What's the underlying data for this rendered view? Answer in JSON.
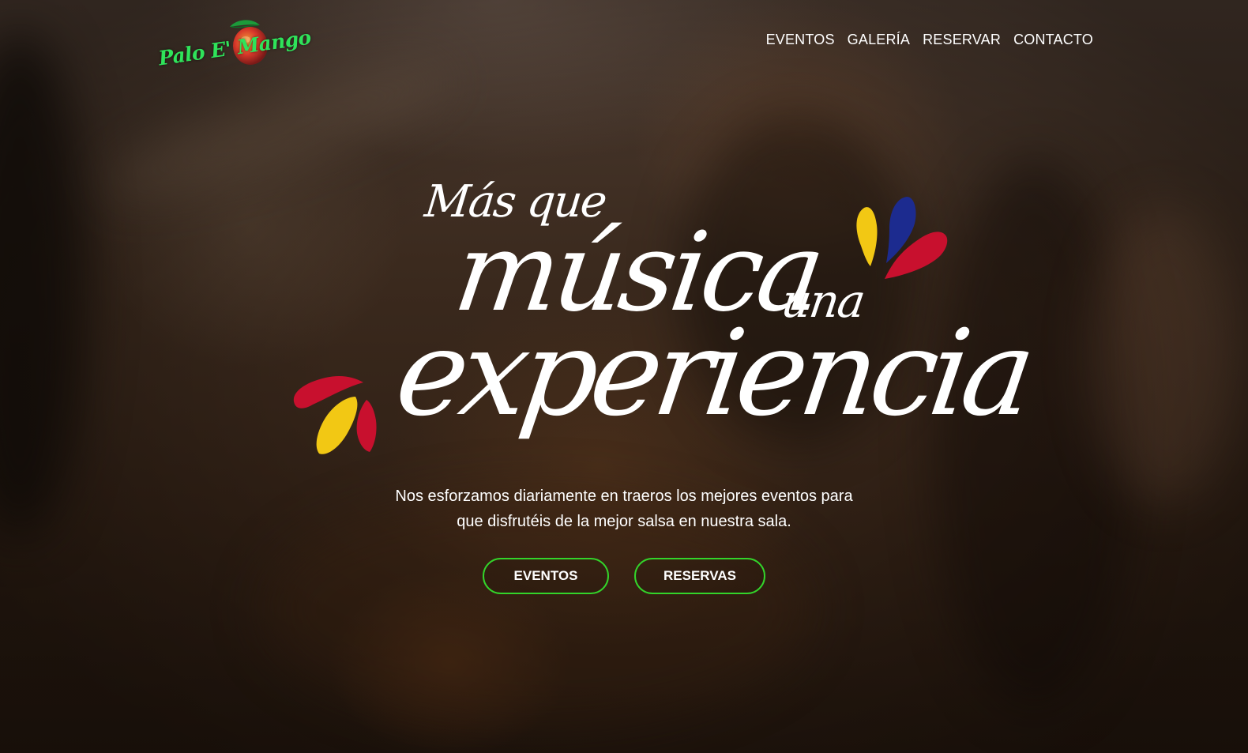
{
  "header": {
    "logo_text": "Palo E' Mango",
    "nav": [
      {
        "label": "EVENTOS"
      },
      {
        "label": "GALERÍA"
      },
      {
        "label": "RESERVAR"
      },
      {
        "label": "CONTACTO"
      }
    ]
  },
  "hero": {
    "headline": {
      "line1": "Más que",
      "line2": "música",
      "line3": "una",
      "line4": "experiencia"
    },
    "subtitle_line1": "Nos esforzamos diariamente en traeros los mejores eventos para",
    "subtitle_line2": "que disfrutéis de la mejor salsa en nuestra sala.",
    "buttons": {
      "primary": "EVENTOS",
      "secondary": "RESERVAS"
    }
  },
  "icons": {
    "logo_mango": "mango-icon",
    "petals_right": "petals-decoration-icon",
    "petals_left": "petals-decoration-icon"
  },
  "colors": {
    "logo_green": "#2fe35a",
    "button_border": "#33d42a",
    "petal_yellow": "#f2c814",
    "petal_blue": "#1c2b8f",
    "petal_red": "#c8102e",
    "text": "#ffffff"
  }
}
